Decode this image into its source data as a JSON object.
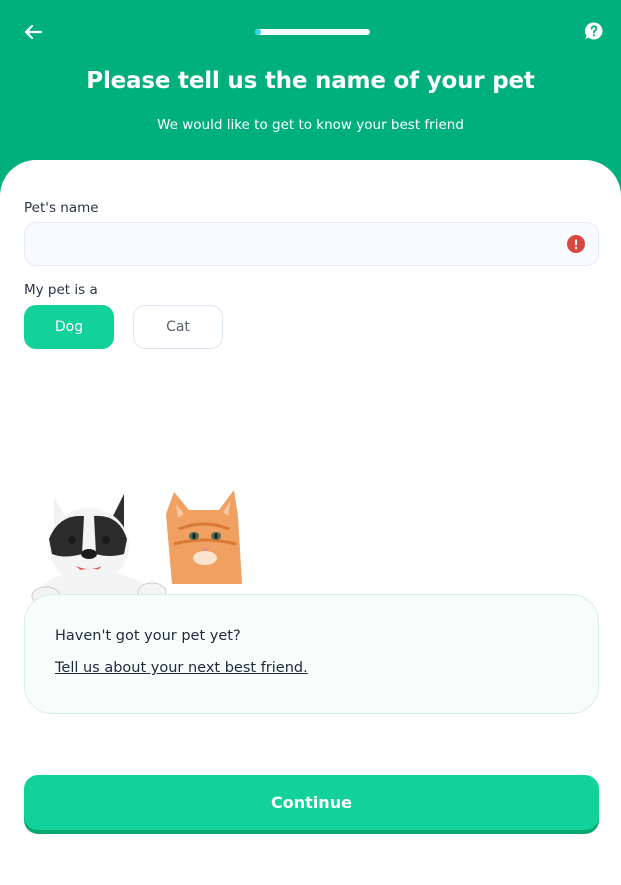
{
  "header": {
    "title": "Please tell us the name of your pet",
    "subtitle": "We would like to get to know your best friend",
    "progress": 0.05,
    "back_icon": "arrow-left-icon",
    "help_icon": "help-bubble-icon"
  },
  "form": {
    "name_label": "Pet's name",
    "name_value": "",
    "name_error_icon": "error-icon",
    "type_label": "My pet is a",
    "options": [
      {
        "label": "Dog",
        "selected": true
      },
      {
        "label": "Cat",
        "selected": false
      }
    ]
  },
  "promo": {
    "question": "Haven't got your pet yet?",
    "link": "Tell us about your next best friend."
  },
  "footer": {
    "continue_label": "Continue"
  },
  "colors": {
    "header_bg": "#00b07c",
    "accent": "#12d19a",
    "progress_fill": "#36d6e7",
    "error": "#d9473f"
  }
}
